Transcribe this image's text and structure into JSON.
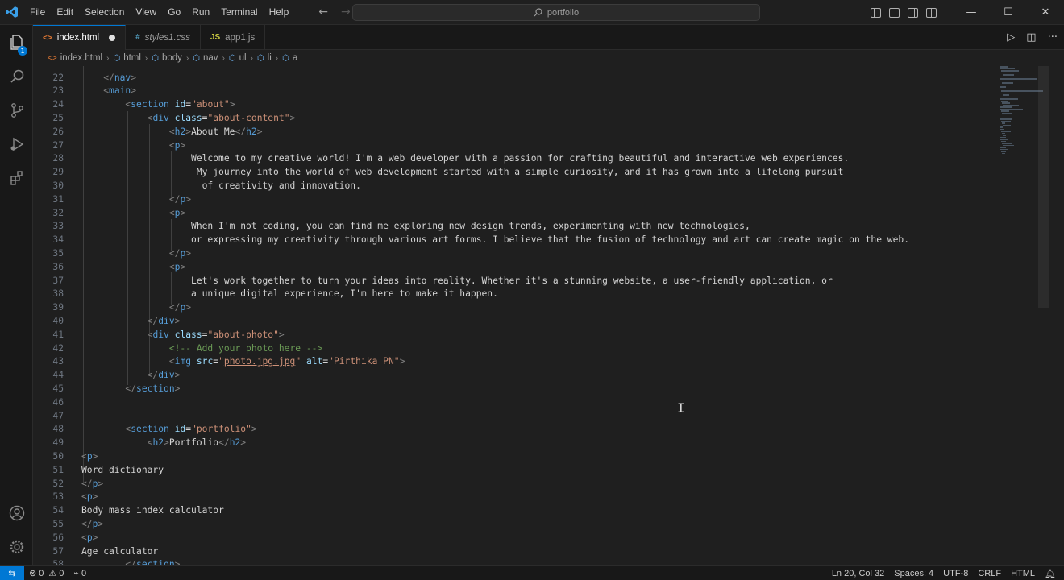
{
  "menu": [
    "File",
    "Edit",
    "Selection",
    "View",
    "Go",
    "Run",
    "Terminal",
    "Help"
  ],
  "search": {
    "text": "portfolio"
  },
  "explorer_badge": "1",
  "tabs": [
    {
      "label": "index.html",
      "icon": "<>",
      "icon_color": "#e37933",
      "active": true,
      "modified": true
    },
    {
      "label": "styles1.css",
      "icon": "#",
      "icon_color": "#519aba",
      "active": false
    },
    {
      "label": "app1.js",
      "icon": "JS",
      "icon_color": "#cbcb41",
      "active": false
    }
  ],
  "breadcrumb": [
    "index.html",
    "html",
    "body",
    "nav",
    "ul",
    "li",
    "a"
  ],
  "editor": {
    "first_line_number": 22,
    "accent": "#0078d4"
  },
  "status": {
    "errors": "0",
    "warnings": "0",
    "ports": "0",
    "position": "Ln 20, Col 32",
    "spaces": "Spaces: 4",
    "encoding": "UTF-8",
    "eol": "CRLF",
    "language": "HTML"
  }
}
